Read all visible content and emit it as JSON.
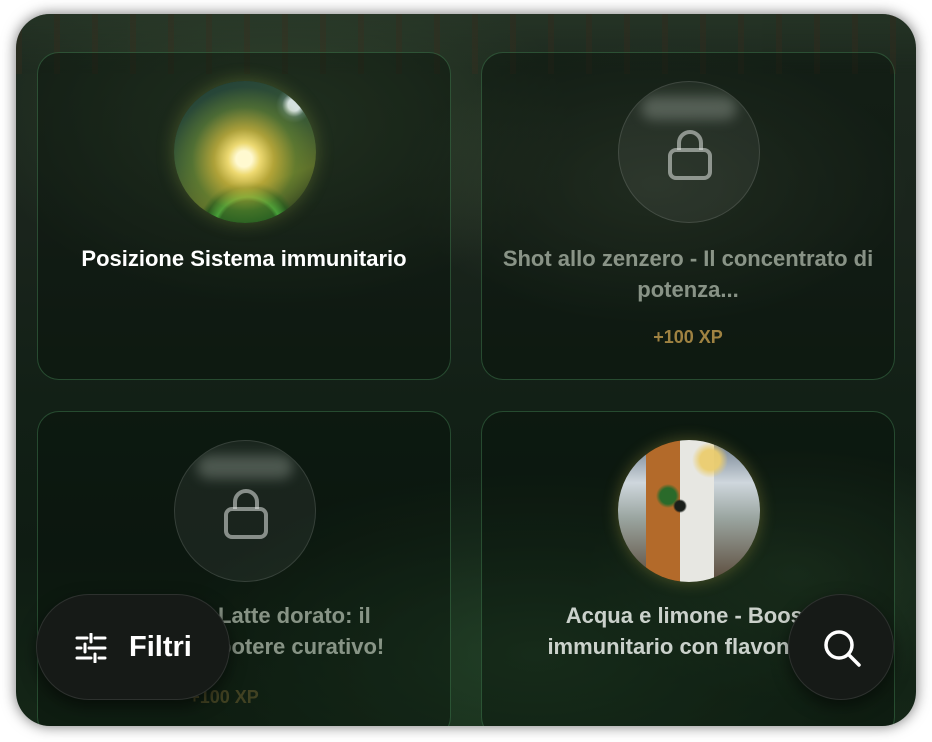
{
  "cards": [
    {
      "title": "Posizione Sistema immunitario",
      "xp": "",
      "locked": false,
      "image": "immune-system-thumbnail"
    },
    {
      "title": "Shot allo zenzero - Il concentrato di potenza...",
      "xp": "+100 XP",
      "locked": true,
      "image": "lock-icon"
    },
    {
      "title": "Latte dorato: il potere curativo!",
      "xp": "+100 XP",
      "locked": true,
      "image": "lock-icon"
    },
    {
      "title": "Acqua e limone - Boost immunitario con flavonoidi",
      "xp": "",
      "locked": false,
      "image": "lemon-water-thumbnail"
    }
  ],
  "filter_button": {
    "label": "Filtri",
    "icon": "sliders-icon"
  },
  "search_button": {
    "icon": "search-icon"
  },
  "colors": {
    "accent_border": "#5aaa6e",
    "xp": "#d7aa55",
    "button_bg": "#161a17"
  }
}
